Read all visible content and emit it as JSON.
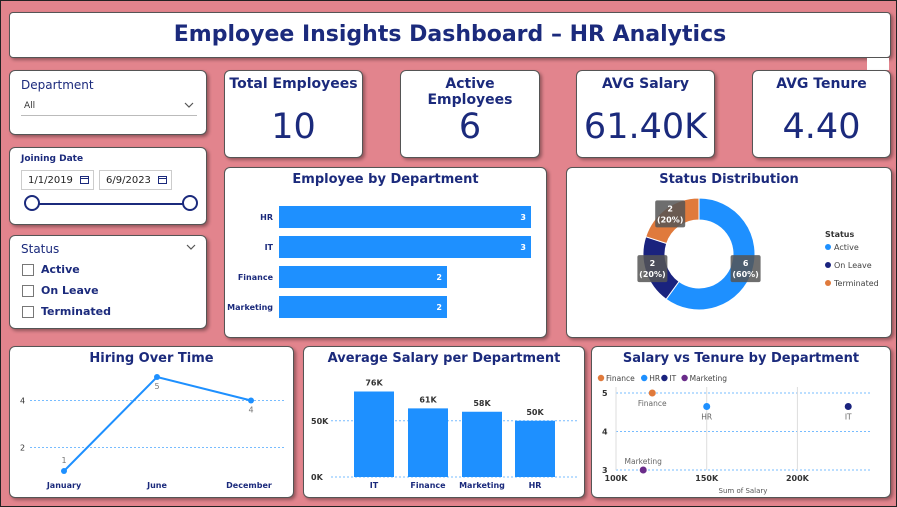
{
  "title": "Employee Insights Dashboard – HR Analytics",
  "slicers": {
    "department": {
      "label": "Department",
      "selected": "All"
    },
    "joining_date": {
      "label": "Joining Date",
      "start": "1/1/2019",
      "end": "6/9/2023"
    },
    "status": {
      "label": "Status",
      "options": [
        "Active",
        "On Leave",
        "Terminated"
      ]
    }
  },
  "kpis": [
    {
      "label": "Total Employees",
      "value": "10"
    },
    {
      "label": "Active Employees",
      "value": "6"
    },
    {
      "label": "AVG Salary",
      "value": "61.40K"
    },
    {
      "label": "AVG Tenure",
      "value": "4.40"
    }
  ],
  "colors": {
    "background": "#e2848d",
    "accent_blue": "#1e90ff",
    "navy": "#1b2a7c",
    "dark_navy": "#1a237e",
    "orange": "#e07a3c",
    "purple": "#6a2c8a"
  },
  "chart_data": [
    {
      "id": "employee-by-department",
      "type": "bar",
      "orientation": "horizontal",
      "title": "Employee by Department",
      "categories": [
        "HR",
        "IT",
        "Finance",
        "Marketing"
      ],
      "values": [
        3,
        3,
        2,
        2
      ],
      "xlim": [
        0,
        3
      ]
    },
    {
      "id": "status-distribution",
      "type": "pie",
      "donut": true,
      "title": "Status Distribution",
      "legend_title": "Status",
      "legend_position": "right",
      "categories": [
        "Active",
        "On Leave",
        "Terminated"
      ],
      "values": [
        6,
        2,
        2
      ],
      "labels": [
        [
          "6",
          "(60%)"
        ],
        [
          "2",
          "(20%)"
        ],
        [
          "2",
          "(20%)"
        ]
      ]
    },
    {
      "id": "hiring-over-time",
      "type": "line",
      "title": "Hiring Over Time",
      "categories": [
        "January",
        "June",
        "December"
      ],
      "values": [
        1,
        5,
        4
      ],
      "ylim": [
        1,
        5
      ],
      "yticks": [
        "2",
        "4"
      ],
      "ytick_values": [
        2,
        4
      ]
    },
    {
      "id": "average-salary-per-department",
      "type": "bar",
      "title": "Average Salary per Department",
      "categories": [
        "IT",
        "Finance",
        "Marketing",
        "HR"
      ],
      "values": [
        76,
        61,
        58,
        50
      ],
      "value_labels": [
        "76K",
        "61K",
        "58K",
        "50K"
      ],
      "ylim": [
        0,
        80
      ],
      "yticks": [
        "0K",
        "50K"
      ],
      "ytick_values": [
        0,
        50
      ]
    },
    {
      "id": "salary-vs-tenure",
      "type": "scatter",
      "title": "Salary vs Tenure by Department",
      "xlabel": "Sum of Salary",
      "legend_position": "top-left",
      "series": [
        {
          "name": "Finance",
          "points": [
            {
              "x": 120,
              "y": 5,
              "label": "Finance"
            }
          ]
        },
        {
          "name": "HR",
          "points": [
            {
              "x": 150,
              "y": 4.65,
              "label": "HR"
            }
          ]
        },
        {
          "name": "IT",
          "points": [
            {
              "x": 228,
              "y": 4.65,
              "label": "IT"
            }
          ]
        },
        {
          "name": "Marketing",
          "points": [
            {
              "x": 115,
              "y": 3,
              "label": "Marketing"
            }
          ]
        }
      ],
      "xlim": [
        100,
        240
      ],
      "ylim": [
        3,
        5
      ],
      "xticks": [
        "100K",
        "150K",
        "200K"
      ],
      "xtick_values": [
        100,
        150,
        200
      ],
      "yticks": [
        "3",
        "4",
        "5"
      ],
      "ytick_values": [
        3,
        4,
        5
      ]
    }
  ]
}
